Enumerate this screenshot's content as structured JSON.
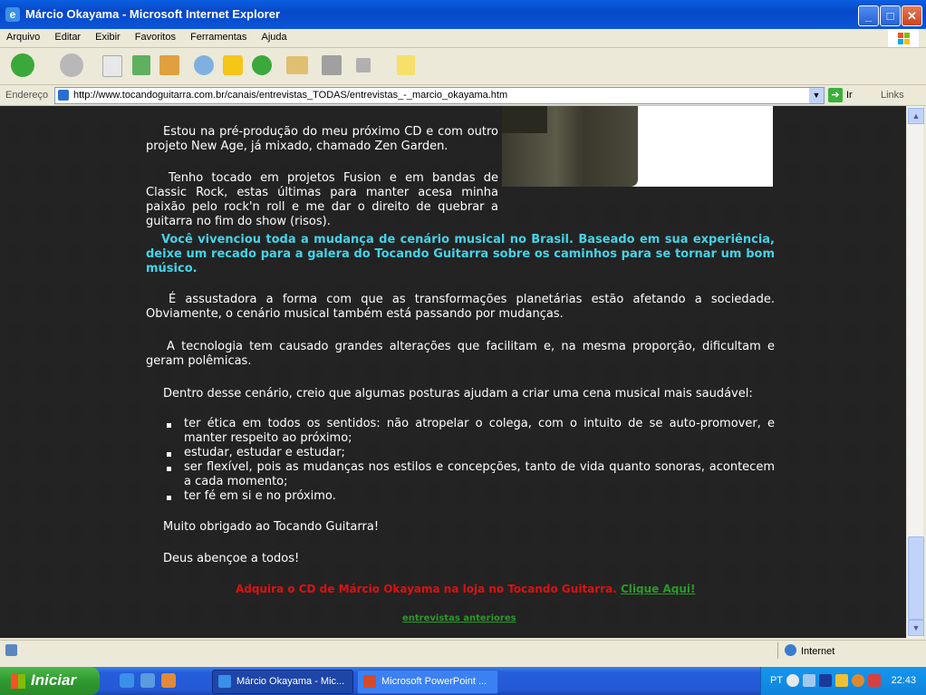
{
  "window": {
    "title": "Márcio Okayama - Microsoft Internet Explorer",
    "minimize_icon": "minimize-icon",
    "maximize_icon": "maximize-icon",
    "close_icon": "close-icon"
  },
  "menu": [
    "Arquivo",
    "Editar",
    "Exibir",
    "Favoritos",
    "Ferramentas",
    "Ajuda"
  ],
  "address": {
    "label": "Endereço",
    "url": "http://www.tocandoguitarra.com.br/canais/entrevistas_TODAS/entrevistas_-_marcio_okayama.htm",
    "go_label": "Ir",
    "links_label": "Links"
  },
  "content": {
    "p1": "Estou na pré-produção do meu próximo CD e com outro projeto New Age, já mixado, chamado Zen Garden.",
    "p2": "Tenho tocado em projetos Fusion e em bandas de Classic Rock, estas últimas para manter acesa minha paixão pelo rock'n roll e me dar o direito de quebrar a guitarra no fim do show (risos).",
    "question": "Você vivenciou toda a mudança de cenário musical no Brasil. Baseado em sua experiência, deixe um recado para a galera do Tocando Guitarra sobre os caminhos para se tornar um bom músico.",
    "a1": "É assustadora a forma com que as transformações planetárias estão afetando a sociedade. Obviamente, o cenário musical também está passando por mudanças.",
    "a2": "A tecnologia tem causado grandes alterações que facilitam e, na mesma proporção, dificultam e geram polêmicas.",
    "a3": "Dentro desse cenário, creio que algumas posturas ajudam a criar uma cena musical mais saudável:",
    "items": [
      "ter ética em todos os sentidos: não atropelar o colega, com o intuito de se auto-promover, e manter respeito ao próximo;",
      "estudar, estudar e estudar;",
      "ser flexível, pois as mudanças nos estilos e concepções, tanto de vida quanto sonoras, acontecem a cada momento;",
      "ter fé em si e no próximo."
    ],
    "thanks": "Muito obrigado ao Tocando Guitarra!",
    "bless": "Deus abençoe a todos!",
    "buy_text": "Adquira o CD de Márcio Okayama na loja no Tocando Guitarra.",
    "buy_link": "Clique Aqui!",
    "prev_link": "entrevistas anteriores"
  },
  "status": {
    "zone": "Internet"
  },
  "taskbar": {
    "start": "Iniciar",
    "tasks": [
      "Márcio Okayama - Mic...",
      "Microsoft PowerPoint ..."
    ],
    "lang": "PT",
    "clock": "22:43"
  }
}
